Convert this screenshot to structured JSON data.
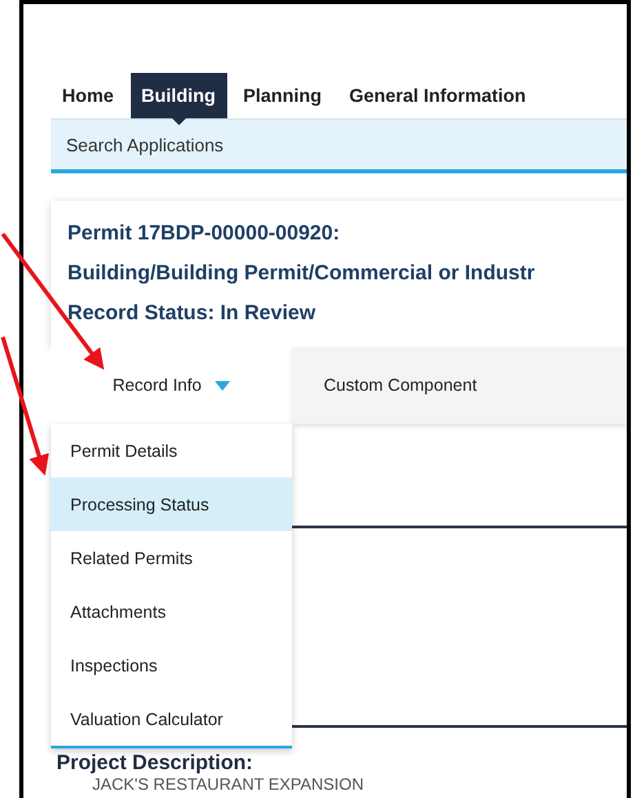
{
  "nav": {
    "tabs": [
      {
        "label": "Home",
        "selected": false
      },
      {
        "label": "Building",
        "selected": true
      },
      {
        "label": "Planning",
        "selected": false
      },
      {
        "label": "General Information",
        "selected": false
      }
    ]
  },
  "subnav": {
    "items": [
      "Search Applications"
    ]
  },
  "record": {
    "title_lines": [
      "Permit 17BDP-00000-00920:",
      "Building/Building Permit/Commercial or Industr",
      "Record Status: In Review"
    ]
  },
  "record_tabs": [
    {
      "label": "Record Info",
      "selected": true,
      "expanded": true
    },
    {
      "label": "Custom Component",
      "selected": false,
      "expanded": false
    }
  ],
  "dropdown": {
    "items": [
      {
        "label": "Permit Details",
        "selected": false
      },
      {
        "label": "Processing Status",
        "selected": true
      },
      {
        "label": "Related Permits",
        "selected": false
      },
      {
        "label": "Attachments",
        "selected": false
      },
      {
        "label": "Inspections",
        "selected": false
      },
      {
        "label": "Valuation Calculator",
        "selected": false
      }
    ]
  },
  "details": {
    "label": "Project Description:",
    "value": "JACK'S RESTAURANT EXPANSION"
  }
}
